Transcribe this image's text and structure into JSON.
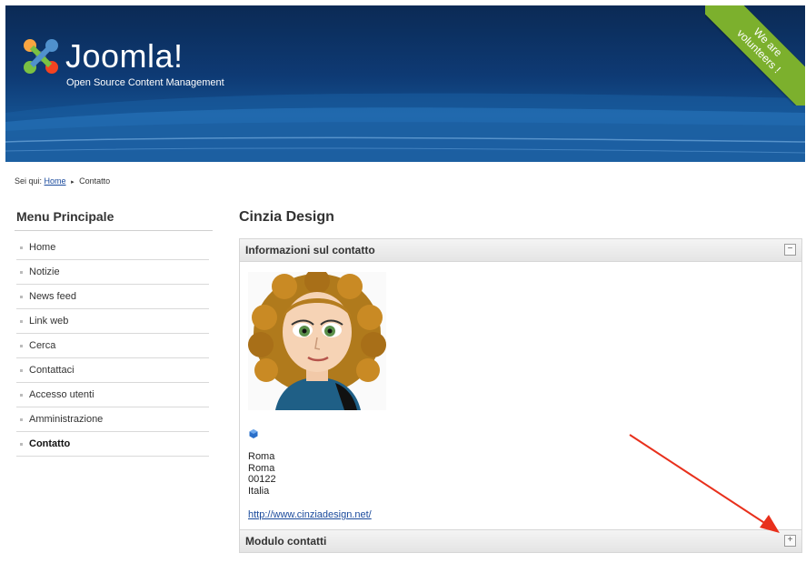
{
  "header": {
    "brand": "Joomla!",
    "tagline": "Open Source Content Management",
    "ribbon_line1": "We are",
    "ribbon_line2": "volunteers !",
    "colors": {
      "banner": "#0e3a74",
      "ribbon": "#7cb02d"
    }
  },
  "breadcrumb": {
    "prefix": "Sei qui:",
    "home": "Home",
    "current": "Contatto"
  },
  "sidebar": {
    "title": "Menu Principale",
    "items": [
      {
        "label": "Home"
      },
      {
        "label": "Notizie"
      },
      {
        "label": "News feed"
      },
      {
        "label": "Link web"
      },
      {
        "label": "Cerca"
      },
      {
        "label": "Contattaci"
      },
      {
        "label": "Accesso utenti"
      },
      {
        "label": "Amministrazione"
      },
      {
        "label": "Contatto",
        "active": true
      }
    ]
  },
  "main": {
    "title": "Cinzia Design",
    "contact_panel": {
      "heading": "Informazioni sul contatto",
      "toggle": "−",
      "address": [
        "Roma",
        "Roma",
        "00122",
        "Italia"
      ],
      "website": "http://www.cinziadesign.net/"
    },
    "form_panel": {
      "heading": "Modulo contatti",
      "toggle": "+"
    }
  },
  "annotation": {
    "arrow_color": "#e8301c"
  }
}
